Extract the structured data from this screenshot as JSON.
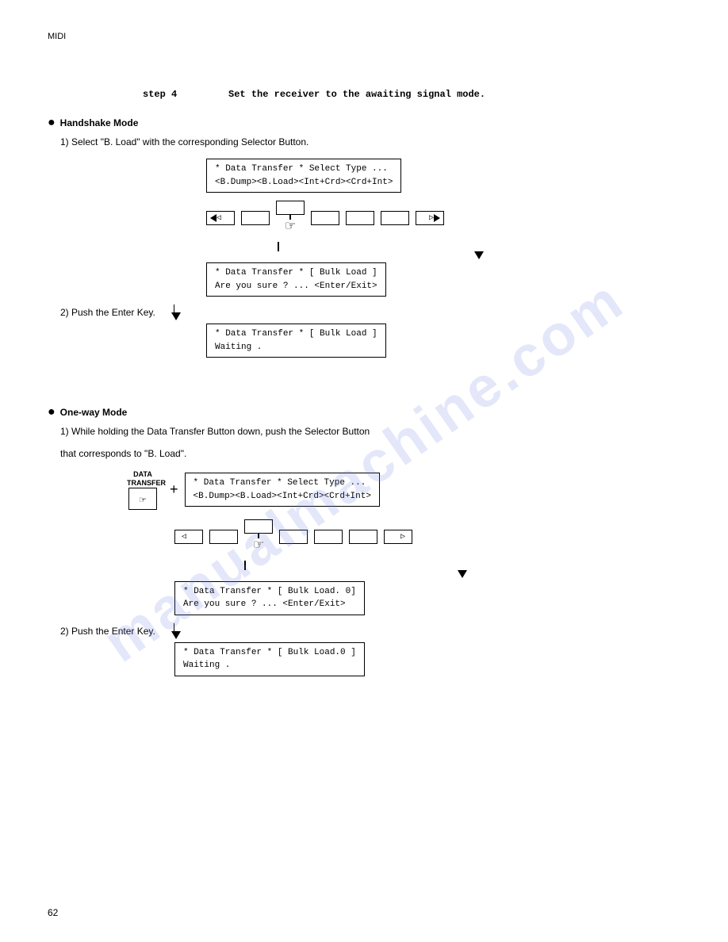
{
  "header": {
    "label": "MIDI"
  },
  "step4": {
    "label": "step 4",
    "instruction": "Set the receiver to the awaiting signal mode."
  },
  "handshake": {
    "title": "Handshake Mode",
    "step1": "1) Select  \"B. Load\"  with the corresponding Selector Button.",
    "screen1_line1": "* Data Transfer *      Select Type ...",
    "screen1_line2": "<B.Dump><B.Load><Int+Crd><Crd+Int>",
    "screen2_line1": "* Data Transfer *      [ Bulk Load ]",
    "screen2_line2": "   Are you sure ? ...   <Enter/Exit>",
    "step2": "2) Push the Enter Key.",
    "screen3_line1": "* Data Transfer *      [ Bulk Load ]",
    "screen3_line2": "         Waiting ."
  },
  "oneway": {
    "title": "One-way  Mode",
    "step1": "1) While holding the Data Transfer Button down, push the Selector Button",
    "step1b": "   that corresponds to \"B. Load\".",
    "data_transfer_label": "DATA\nTRANSFER",
    "plus": "+",
    "screen1_line1": "* Data Transfer *      Select Type ...",
    "screen1_line2": "<B.Dump><B.Load><Int+Crd><Crd+Int>",
    "screen2_line1": "* Data Transfer *       [ Bulk Load. 0]",
    "screen2_line2": "   Are you sure ? ...   <Enter/Exit>",
    "step2": "2) Push the Enter Key.",
    "screen3_line1": "* Data Transfer *       [ Bulk Load.0 ]",
    "screen3_line2": "         Waiting ."
  },
  "page_number": "62",
  "watermark": "manualmachine.com"
}
